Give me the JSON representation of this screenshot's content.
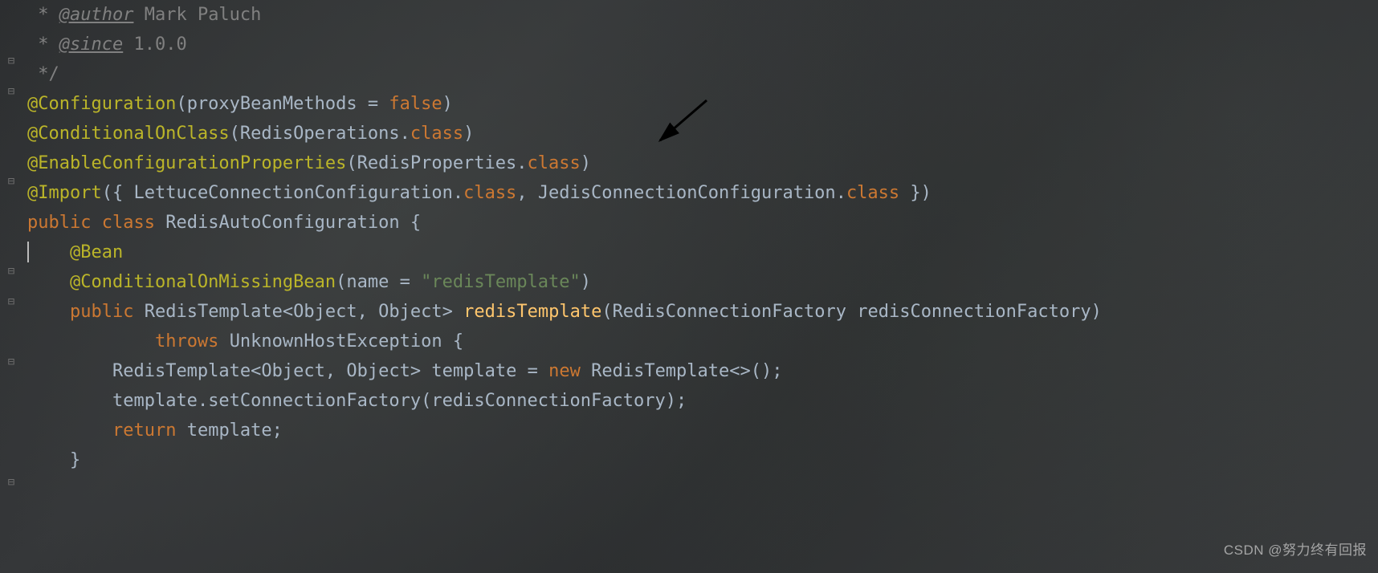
{
  "code": {
    "doc_author_tag": "@author",
    "doc_author_name": "Mark Paluch",
    "doc_since_tag": "@since",
    "doc_since_val": "1.0.0",
    "doc_close": "*/",
    "ann_configuration": "@Configuration",
    "proxyBeanMethods": "proxyBeanMethods",
    "false_kw": "false",
    "ann_conditionalOnClass": "@ConditionalOnClass",
    "redisOperations": "RedisOperations",
    "class_kw": "class",
    "ann_enableConfigProps": "@EnableConfigurationProperties",
    "redisProperties": "RedisProperties",
    "ann_import": "@Import",
    "lettuceConnConfig": "LettuceConnectionConfiguration",
    "jedisConnConfig": "JedisConnectionConfiguration",
    "public_kw": "public",
    "class_decl_kw": "class",
    "redisAutoConfig": "RedisAutoConfiguration",
    "ann_bean": "@Bean",
    "ann_conditionalOnMissingBean": "@ConditionalOnMissingBean",
    "name_param": "name",
    "redisTemplate_str": "\"redisTemplate\"",
    "redisTemplateType": "RedisTemplate",
    "objectType": "Object",
    "redisTemplate_method": "redisTemplate",
    "redisConnFactoryType": "RedisConnectionFactory",
    "redisConnFactoryParam": "redisConnectionFactory",
    "throws_kw": "throws",
    "unknownHostException": "UnknownHostException",
    "template_var": "template",
    "new_kw": "new",
    "setConnFactory": "setConnectionFactory",
    "return_kw": "return"
  },
  "watermark": "CSDN @努力终有回报"
}
